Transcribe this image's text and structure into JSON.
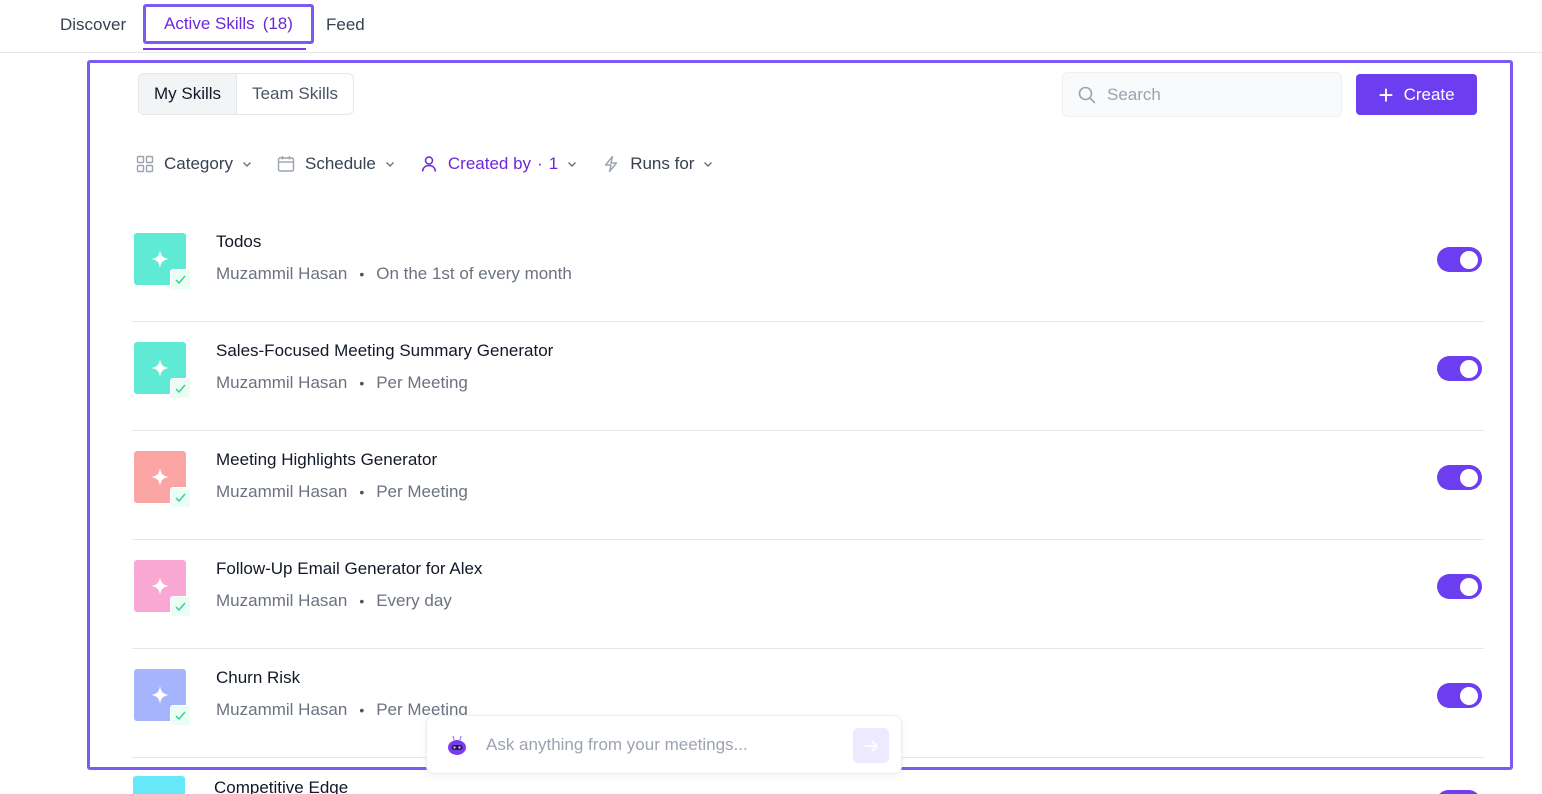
{
  "top_tabs": [
    {
      "label": "Discover"
    },
    {
      "label": "Active Skills",
      "count": "(18)"
    },
    {
      "label": "Feed"
    }
  ],
  "view_toggle": {
    "my_skills": "My Skills",
    "team_skills": "Team Skills"
  },
  "search": {
    "placeholder": "Search"
  },
  "create_label": "Create",
  "filters": {
    "category": "Category",
    "schedule": "Schedule",
    "created_by": "Created by",
    "created_by_count": "1",
    "runs_for": "Runs for"
  },
  "skills": [
    {
      "title": "Todos",
      "author": "Muzammil Hasan",
      "schedule": "On the 1st of every month",
      "color": "#5eead4",
      "enabled": true
    },
    {
      "title": "Sales-Focused Meeting Summary Generator",
      "author": "Muzammil Hasan",
      "schedule": "Per Meeting",
      "color": "#5eead4",
      "enabled": true
    },
    {
      "title": "Meeting Highlights Generator",
      "author": "Muzammil Hasan",
      "schedule": "Per Meeting",
      "color": "#fca5a5",
      "enabled": true
    },
    {
      "title": "Follow-Up Email Generator for Alex",
      "author": "Muzammil Hasan",
      "schedule": "Every day",
      "color": "#f9a8d4",
      "enabled": true
    },
    {
      "title": "Churn Risk",
      "author": "Muzammil Hasan",
      "schedule": "Per Meeting",
      "color": "#a5b4fc",
      "enabled": true
    },
    {
      "title": "Competitive Edge",
      "color": "#67e8f9",
      "enabled": true
    }
  ],
  "ask_bar": {
    "placeholder": "Ask anything from your meetings..."
  },
  "colors": {
    "accent": "#6d3df0",
    "highlight_border": "#7c5cf0"
  }
}
